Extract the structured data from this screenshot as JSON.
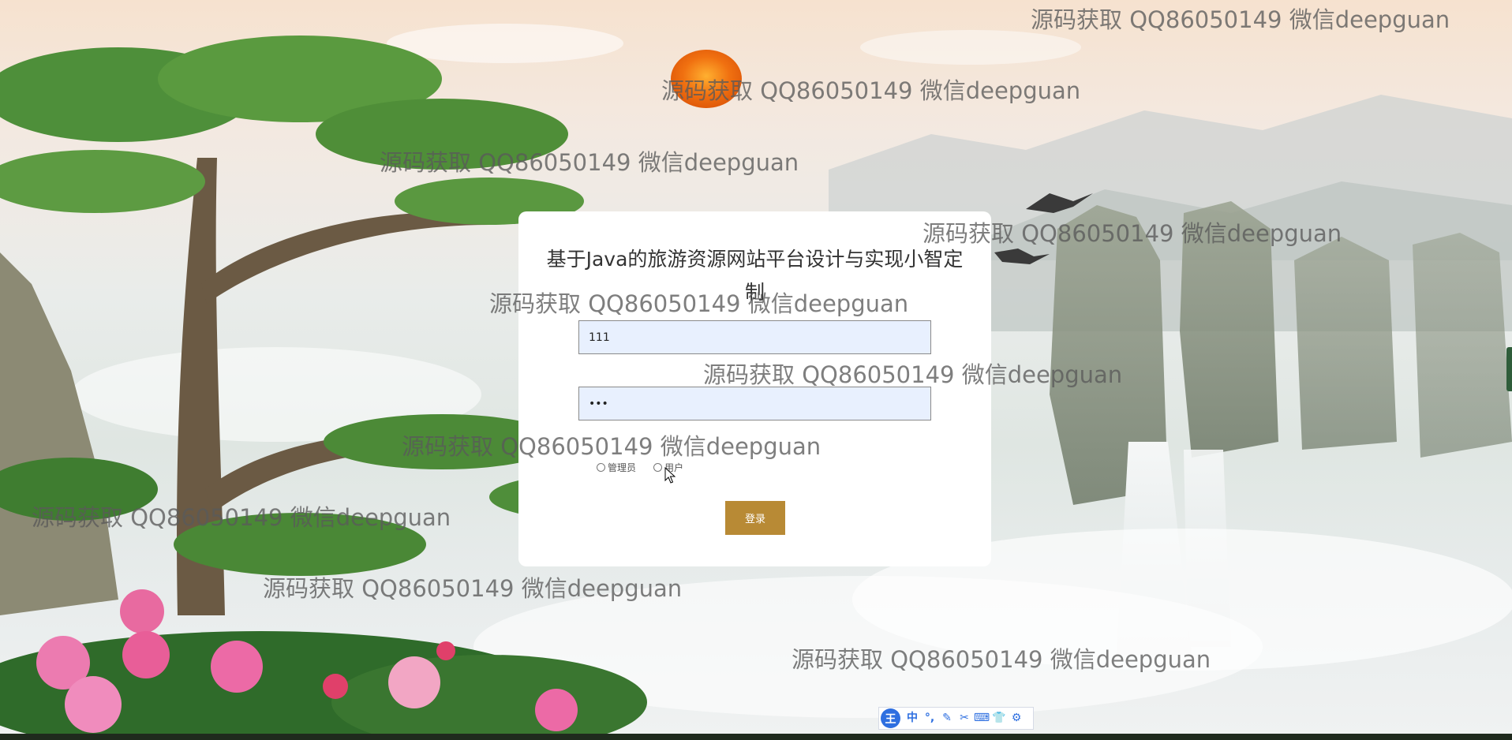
{
  "page": {
    "title": "基于Java的旅游资源网站平台设计与实现小智定制"
  },
  "login": {
    "account_value": "111",
    "password_value": "111",
    "roles": [
      {
        "label": "管理员",
        "selected": false
      },
      {
        "label": "用户",
        "selected": false
      }
    ],
    "submit_label": "登录"
  },
  "watermarks": [
    "源码获取 QQ86050149 微信deepguan",
    "源码获取 QQ86050149 微信deepguan",
    "源码获取 QQ86050149 微信deepguan",
    "源码获取 QQ86050149 微信deepguan",
    "源码获取 QQ86050149 微信deepguan",
    "源码获取 QQ86050149 微信deepguan",
    "源码获取 QQ86050149 微信deepguan",
    "源码获取 QQ86050149 微信deepguan",
    "源码获取 QQ86050149 微信deepguan",
    "源码获取 QQ86050149 微信deepguan"
  ],
  "ime_toolbar": {
    "logo": "王",
    "items": [
      "中",
      "°,",
      "✎",
      "✂",
      "⌨",
      "👕",
      "⚙"
    ]
  },
  "colors": {
    "button": "#b88a35",
    "input_background": "#e8f0fe",
    "ime_accent": "#2e6fe0"
  }
}
